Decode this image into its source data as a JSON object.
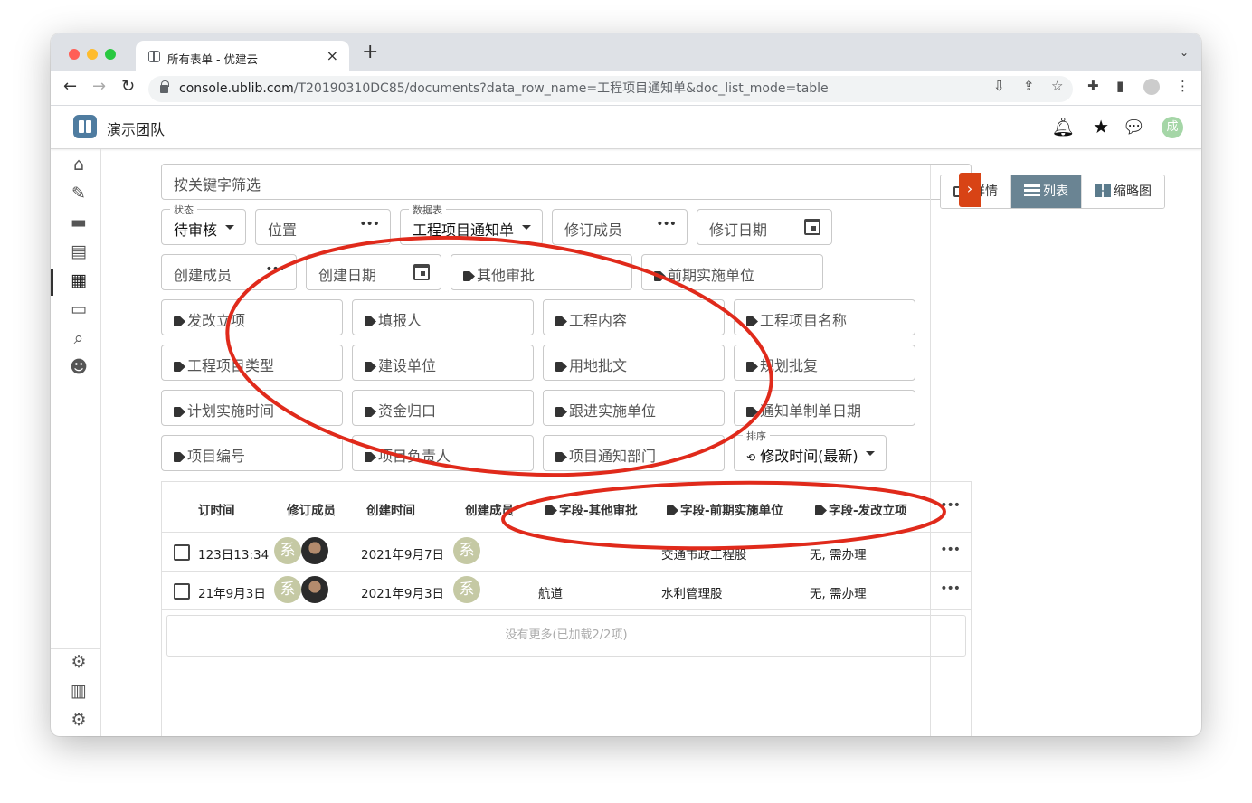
{
  "browser": {
    "tab_title": "所有表单 - 优建云",
    "url_host": "console.ublib.com",
    "url_path": "/T20190310DC85/documents?data_row_name=工程项目通知单&doc_list_mode=table",
    "colors": {
      "close": "#ff5f57",
      "minimize": "#febc2e",
      "maximize": "#28c840"
    }
  },
  "app": {
    "team_name": "演示团队",
    "user_initial": "成"
  },
  "filters": {
    "search_placeholder": "按关键字筛选",
    "status_label": "状态",
    "status_value": "待审核",
    "location_placeholder": "位置",
    "datasheet_label": "数据表",
    "datasheet_value": "工程项目通知单",
    "reviser_placeholder": "修订成员",
    "revise_date_placeholder": "修订日期",
    "creator_placeholder": "创建成员",
    "create_date_placeholder": "创建日期",
    "tag_fields": [
      "其他审批",
      "前期实施单位",
      "发改立项",
      "填报人",
      "工程内容",
      "工程项目名称",
      "工程项目类型",
      "建设单位",
      "用地批文",
      "规划批复",
      "计划实施时间",
      "资金归口",
      "跟进实施单位",
      "通知单制单日期",
      "项目编号",
      "项目负责人",
      "项目通知部门"
    ],
    "sort_label": "排序",
    "sort_value": "修改时间(最新)"
  },
  "table": {
    "headers": [
      "订时间",
      "修订成员",
      "创建时间",
      "创建成员",
      "字段-其他审批",
      "字段-前期实施单位",
      "字段-发改立项"
    ],
    "rows": [
      {
        "revise_time": "123日13:34",
        "reviser_initial": "系",
        "create_time": "2021年9月7日",
        "creator_initial": "系",
        "other_approval": "",
        "pre_unit": "交通市政工程股",
        "ndrc": "无, 需办理"
      },
      {
        "revise_time": "21年9月3日",
        "reviser_initial": "系",
        "create_time": "2021年9月3日",
        "creator_initial": "系",
        "other_approval": "航道",
        "pre_unit": "水利管理股",
        "ndrc": "无, 需办理"
      }
    ],
    "footer": "没有更多(已加载2/2项)"
  },
  "view_modes": {
    "detail": "详情",
    "list": "列表",
    "thumb": "缩略图",
    "active": "列表"
  },
  "annotation_color": "#e02a1b"
}
